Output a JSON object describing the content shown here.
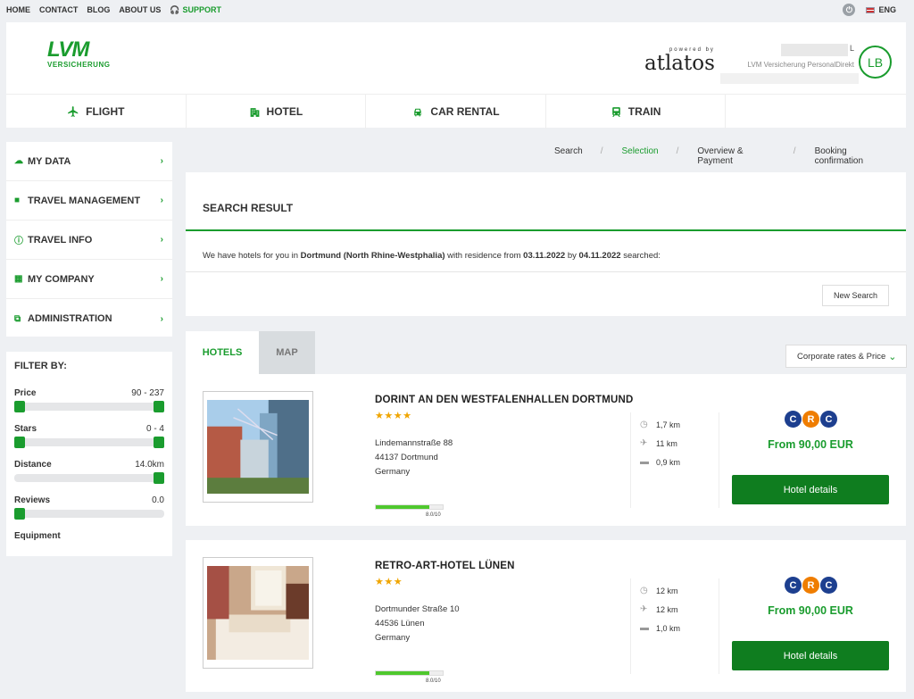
{
  "topbar": {
    "links": [
      "HOME",
      "CONTACT",
      "BLOG",
      "ABOUT US"
    ],
    "support": "SUPPORT",
    "lang": "ENG"
  },
  "header": {
    "logo_main": "LVM",
    "logo_sub": "VERSICHERUNG",
    "powered_by": "powered by",
    "brand": "atlatos",
    "user_initial_suffix": "L",
    "user_company": "LVM Versicherung PersonalDirekt",
    "avatar": "LB"
  },
  "nav": {
    "tabs": [
      {
        "label": "FLIGHT",
        "icon": "airplane-icon"
      },
      {
        "label": "HOTEL",
        "icon": "building-icon"
      },
      {
        "label": "CAR RENTAL",
        "icon": "car-icon"
      },
      {
        "label": "TRAIN",
        "icon": "train-icon"
      }
    ]
  },
  "sidebar": {
    "items": [
      {
        "label": "MY DATA",
        "icon": "cloud-icon"
      },
      {
        "label": "TRAVEL MANAGEMENT",
        "icon": "briefcase-icon"
      },
      {
        "label": "TRAVEL INFO",
        "icon": "info-icon"
      },
      {
        "label": "MY COMPANY",
        "icon": "buildings-icon"
      },
      {
        "label": "ADMINISTRATION",
        "icon": "network-icon"
      }
    ]
  },
  "filter": {
    "title": "FILTER BY:",
    "price_label": "Price",
    "price_value": "90 - 237",
    "stars_label": "Stars",
    "stars_value": "0 - 4",
    "distance_label": "Distance",
    "distance_value": "14.0km",
    "reviews_label": "Reviews",
    "reviews_value": "0.0",
    "equipment_label": "Equipment"
  },
  "steps": [
    "Search",
    "Selection",
    "Overview & Payment",
    "Booking confirmation"
  ],
  "results": {
    "title": "SEARCH RESULT",
    "msg_prefix": "We have hotels for you in",
    "city": "Dortmund (North Rhine-Westphalia)",
    "msg_mid": "with residence from",
    "date_from": "03.11.2022",
    "msg_by": "by",
    "date_to": "04.11.2022",
    "msg_suffix": "searched:",
    "new_search": "New Search"
  },
  "tabs": {
    "hotels": "HOTELS",
    "map": "MAP"
  },
  "sort": {
    "label": "Corporate rates & Price"
  },
  "hotels": [
    {
      "name": "DORINT AN DEN WESTFALENHALLEN DORTMUND",
      "stars": "★★★★",
      "street": "Lindemannstraße 88",
      "city": "44137 Dortmund",
      "country": "Germany",
      "rating": "8.0/10",
      "rating_value": 0.8,
      "dist_center": "1,7 km",
      "dist_airport": "11 km",
      "dist_train": "0,9 km",
      "price": "From 90,00 EUR",
      "button": "Hotel details"
    },
    {
      "name": "RETRO-ART-HOTEL LÜNEN",
      "stars": "★★★",
      "street": "Dortmunder Straße 10",
      "city": "44536 Lünen",
      "country": "Germany",
      "rating": "8.0/10",
      "rating_value": 0.8,
      "dist_center": "12 km",
      "dist_airport": "12 km",
      "dist_train": "1,0 km",
      "price": "From 90,00 EUR",
      "button": "Hotel details"
    }
  ],
  "crc": {
    "letters": [
      "C",
      "R",
      "C"
    ],
    "colors": [
      "#1d3f8f",
      "#ef7d00",
      "#1d3f8f"
    ]
  },
  "accent": "#1a9c2e"
}
